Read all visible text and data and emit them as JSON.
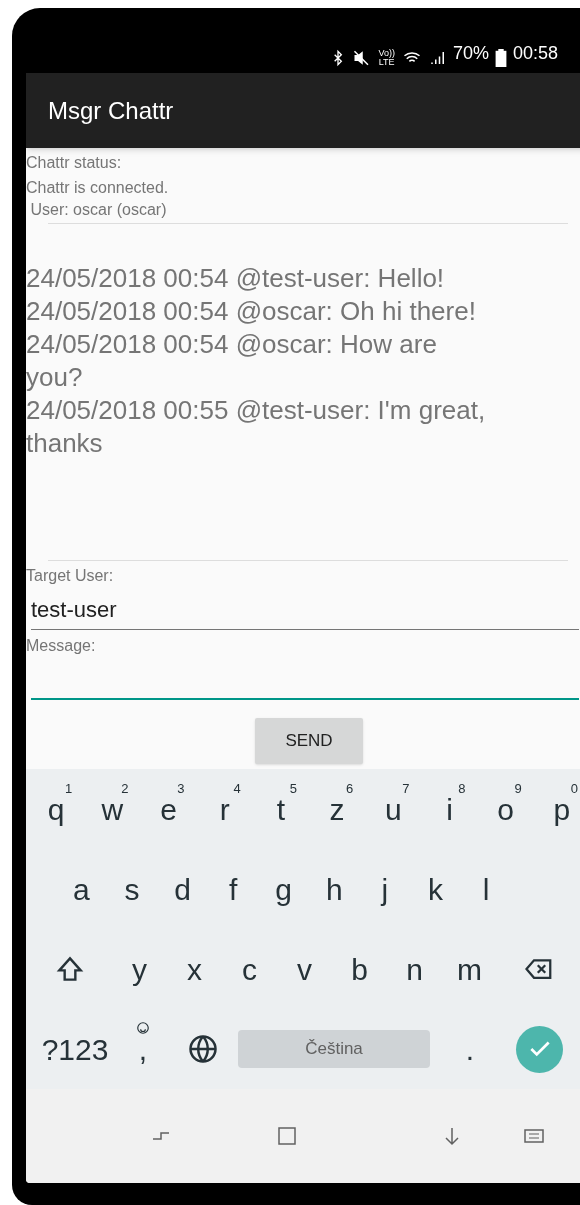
{
  "status_bar": {
    "volte_top": "Vo))",
    "volte_bottom": "LTE",
    "battery": "70%",
    "time": "00:58"
  },
  "app_bar": {
    "title": "Msgr Chattr"
  },
  "status": {
    "label": "Chattr status:",
    "connection": "Chattr is connected.",
    "user": " User: oscar (oscar)"
  },
  "messages": [
    "24/05/2018 00:54 @test-user: Hello!",
    "24/05/2018 00:54 @oscar: Oh hi there!",
    "24/05/2018 00:54 @oscar: How are you?",
    "24/05/2018 00:55 @test-user: I'm great, thanks"
  ],
  "target_field": {
    "label": "Target User:",
    "value": "test-user",
    "focused": false
  },
  "message_field": {
    "label": "Message:",
    "focused": true
  },
  "send_button": "SEND",
  "keyboard": {
    "row1": [
      {
        "key": "q",
        "hint": "1"
      },
      {
        "key": "w",
        "hint": "2"
      },
      {
        "key": "e",
        "hint": "3"
      },
      {
        "key": "r",
        "hint": "4"
      },
      {
        "key": "t",
        "hint": "5"
      },
      {
        "key": "z",
        "hint": "6"
      },
      {
        "key": "u",
        "hint": "7"
      },
      {
        "key": "i",
        "hint": "8"
      },
      {
        "key": "o",
        "hint": "9"
      },
      {
        "key": "p",
        "hint": "0"
      }
    ],
    "row2": [
      "a",
      "s",
      "d",
      "f",
      "g",
      "h",
      "j",
      "k",
      "l"
    ],
    "row3": [
      "y",
      "x",
      "c",
      "v",
      "b",
      "n",
      "m"
    ],
    "symbols": "?123",
    "comma": ",",
    "space": "Čeština",
    "period": "."
  }
}
